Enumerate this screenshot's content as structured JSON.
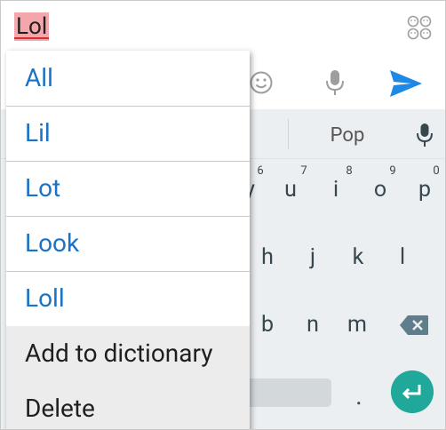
{
  "text_field": {
    "typed_word": "Lol"
  },
  "compose": {
    "emoji_icon": "smiley-face-icon",
    "mic_icon": "microphone-icon",
    "send_icon": "send-arrow-icon"
  },
  "suggestion_strip": {
    "right_suggestion": "Pop",
    "mic_icon": "microphone-icon"
  },
  "keyboard": {
    "number_hints": {
      "h6": "6",
      "h7": "7",
      "h8": "8",
      "h9": "9",
      "h0": "0"
    },
    "row1": {
      "y": "y",
      "u": "u",
      "i": "i",
      "o": "o",
      "p": "p"
    },
    "row2": {
      "h": "h",
      "j": "j",
      "k": "k",
      "l": "l"
    },
    "row3": {
      "b": "b",
      "n": "n",
      "m": "m"
    },
    "period_key": "."
  },
  "popup_menu": {
    "suggestions": [
      "All",
      "Lil",
      "Lot",
      "Look",
      "Loll"
    ],
    "add_to_dictionary": "Add to dictionary",
    "delete": "Delete"
  },
  "colors": {
    "link_blue": "#1a73c5",
    "send_blue": "#1e88e5",
    "enter_teal": "#20a89a",
    "highlight_pink": "#f4a6ad",
    "keyboard_bg": "#eceff1"
  }
}
